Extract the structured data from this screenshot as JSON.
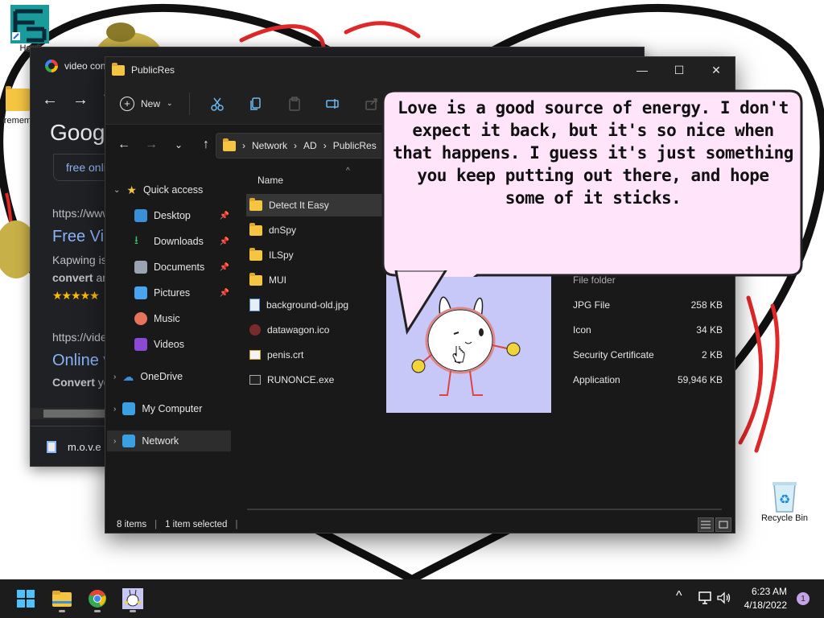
{
  "desktop": {
    "icons": [
      {
        "label": "Howf"
      },
      {
        "label": "remem"
      },
      {
        "label": "Recycle Bin"
      }
    ]
  },
  "chrome": {
    "tab_title": "video con",
    "google_logo": "Goog",
    "chip_text": "free onli",
    "url_1": "https://www",
    "link_1": "Free Vi",
    "text_1": "Kapwing is",
    "bold_1": "convert",
    "bold_1_rest": "an",
    "stars": "★★★★★",
    "url_2": "https://vide",
    "link_2": "Online v",
    "bold_2": "Convert",
    "bold_2_rest": "yo",
    "download_item": "m.o.v.e"
  },
  "explorer": {
    "title": "PublicRes",
    "new_label": "New",
    "breadcrumb": [
      "Network",
      "AD",
      "PublicRes"
    ],
    "column_name": "Name",
    "nav": {
      "quick_access": "Quick access",
      "desktop": "Desktop",
      "downloads": "Downloads",
      "documents": "Documents",
      "pictures": "Pictures",
      "music": "Music",
      "videos": "Videos",
      "onedrive": "OneDrive",
      "my_computer": "My Computer",
      "network": "Network"
    },
    "files": [
      {
        "name": "Detect It Easy",
        "type": "",
        "size": ""
      },
      {
        "name": "dnSpy",
        "type": "",
        "size": ""
      },
      {
        "name": "ILSpy",
        "type": "",
        "size": ""
      },
      {
        "name": "MUI",
        "type": "File folder",
        "size": ""
      },
      {
        "name": "background-old.jpg",
        "type": "JPG File",
        "size": "258 KB"
      },
      {
        "name": "datawagon.ico",
        "type": "Icon",
        "size": "34 KB"
      },
      {
        "name": "penis.crt",
        "type": "Security Certificate",
        "size": "2 KB"
      },
      {
        "name": "RUNONCE.exe",
        "type": "Application",
        "size": "59,946 KB"
      }
    ],
    "status_items": "8 items",
    "status_selected": "1 item selected"
  },
  "bubble": {
    "line1": "Love is a good source of energy. I don't",
    "line2": "expect it back, but it's so nice when",
    "line3": "that happens. I guess it's just something",
    "line4": "you keep putting out there, and hope",
    "line5": "some of it sticks."
  },
  "taskbar": {
    "time": "6:23 AM",
    "date": "4/18/2022",
    "notification_count": "1"
  }
}
